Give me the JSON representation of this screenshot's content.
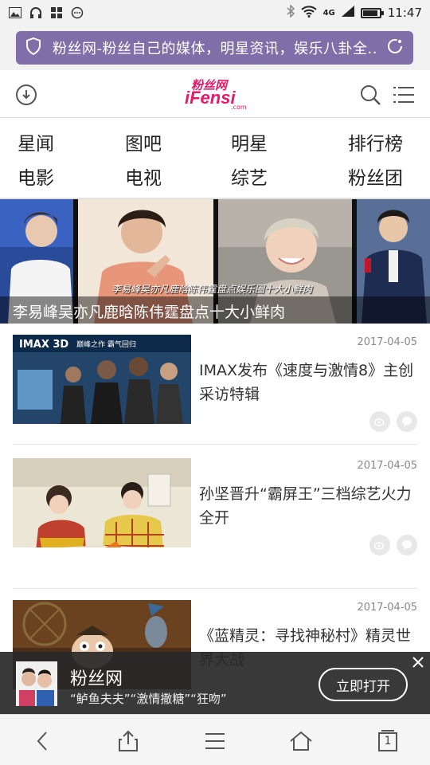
{
  "status_bar": {
    "time": "11:47",
    "network": "4G"
  },
  "url_bar": {
    "title": "粉丝网-粉丝自己的媒体，明星资讯，娱乐八卦全..."
  },
  "site": {
    "logo_cn": "粉丝网",
    "logo_en": "iFensi",
    "logo_domain": ".com"
  },
  "nav": {
    "items": [
      "星闻",
      "图吧",
      "明星",
      "排行榜",
      "电影",
      "电视",
      "综艺",
      "粉丝团"
    ]
  },
  "carousel": {
    "caption": "李易峰吴亦凡鹿晗陈伟霆盘点十大小鲜肉",
    "overlay_caption": "李易峰吴亦凡鹿晗陈伟霆盘点娱乐圈十大小鲜肉"
  },
  "articles": [
    {
      "date": "2017-04-05",
      "title": "IMAX发布《速度与激情8》主创采访特辑",
      "poster_text_1": "IMAX 3D",
      "poster_text_2": "巅峰之作 霸气回归"
    },
    {
      "date": "2017-04-05",
      "title": "孙坚晋升“霸屏王”三档综艺火力全开"
    },
    {
      "date": "2017-04-05",
      "title": "《蓝精灵：寻找神秘村》精灵世界大战"
    }
  ],
  "app_banner": {
    "title": "粉丝网",
    "subtitle": "“鲈鱼夫夫”“激情撒糖”“狂吻”",
    "button": "立即打开"
  },
  "toolbar": {
    "tab_count": "1"
  },
  "colors": {
    "url_bar": "#7f6ea8",
    "brand": "#e6186a",
    "banner": "#282828"
  }
}
